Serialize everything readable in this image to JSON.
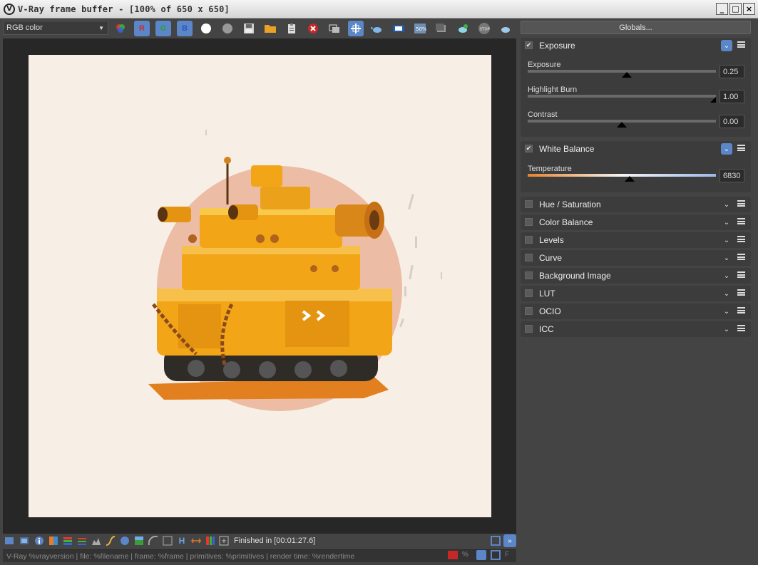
{
  "window": {
    "title": "V-Ray frame buffer - [100% of 650 x 650]",
    "logo_label": "V",
    "buttons": [
      "_",
      "□",
      "×"
    ]
  },
  "toolbar": {
    "channel_select": "RGB color",
    "r_label": "R",
    "g_label": "G",
    "b_label": "B",
    "zoom_label": "50%",
    "stop_label": "STOP"
  },
  "status": {
    "text": "Finished in [00:01:27.6]"
  },
  "infoline": {
    "text": "V-Ray %vrayversion | file: %filename | frame: %frame | primitives: %primitives | render time: %rendertime"
  },
  "sidepanel": {
    "globals_label": "Globals...",
    "exposure": {
      "title": "Exposure",
      "checked": true,
      "sliders": [
        {
          "label": "Exposure",
          "value": "0.25"
        },
        {
          "label": "Highlight Burn",
          "value": "1.00"
        },
        {
          "label": "Contrast",
          "value": "0.00"
        }
      ]
    },
    "white_balance": {
      "title": "White Balance",
      "checked": true,
      "temperature_label": "Temperature",
      "temperature_value": "6830"
    },
    "collapsed": [
      {
        "title": "Hue / Saturation"
      },
      {
        "title": "Color Balance"
      },
      {
        "title": "Levels"
      },
      {
        "title": "Curve"
      },
      {
        "title": "Background Image"
      },
      {
        "title": "LUT"
      },
      {
        "title": "OCIO"
      },
      {
        "title": "ICC"
      }
    ]
  },
  "bottom_icons": {
    "h_label": "H"
  },
  "colors": {
    "accent": "#5b86c7",
    "canvas_bg": "#f7efe6",
    "tank": "#f2a516",
    "halo": "#e8b49a"
  }
}
